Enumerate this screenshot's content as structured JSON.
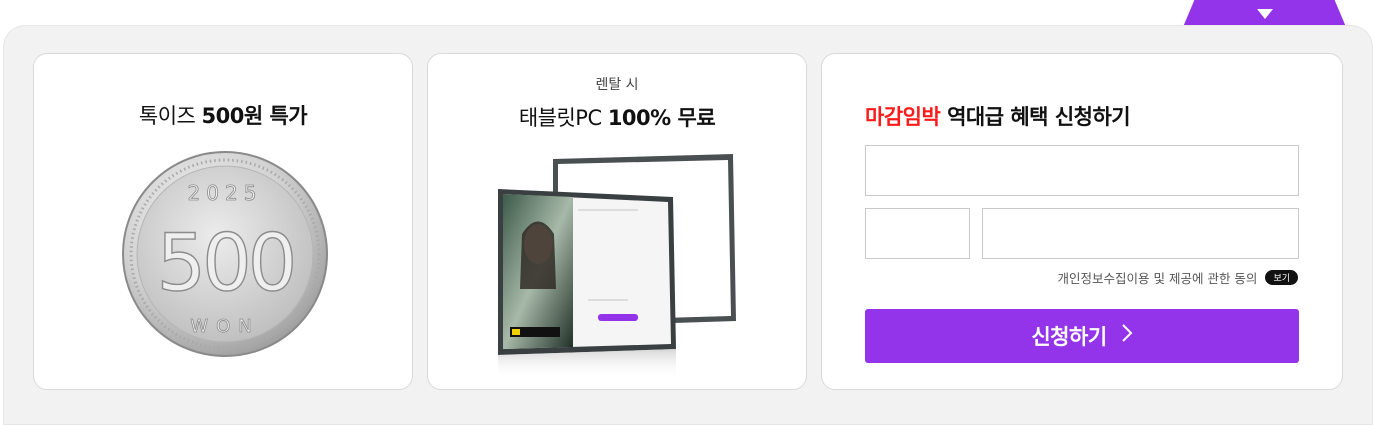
{
  "toggle": {
    "icon": "caret-down-icon"
  },
  "card1": {
    "title_prefix": "톡이즈 ",
    "title_bold": "500원 특가",
    "coin": {
      "year": "2025",
      "value": "500",
      "unit": "WON"
    }
  },
  "card2": {
    "subtitle": "렌탈 시",
    "title_prefix": "태블릿PC ",
    "title_bold": "100% 무료"
  },
  "form": {
    "title_hot": "마감임박",
    "title_rest": " 역대급 혜택 신청하기",
    "name_placeholder": "",
    "prefix_placeholder": "",
    "phone_placeholder": "",
    "agree_text": "개인정보수집이용 및 제공에 관한 동의",
    "view_label": "보기",
    "submit_label": "신청하기",
    "submit_icon": "chevron-right-icon"
  },
  "colors": {
    "accent": "#9333ea",
    "hot": "#ff1a1a"
  }
}
